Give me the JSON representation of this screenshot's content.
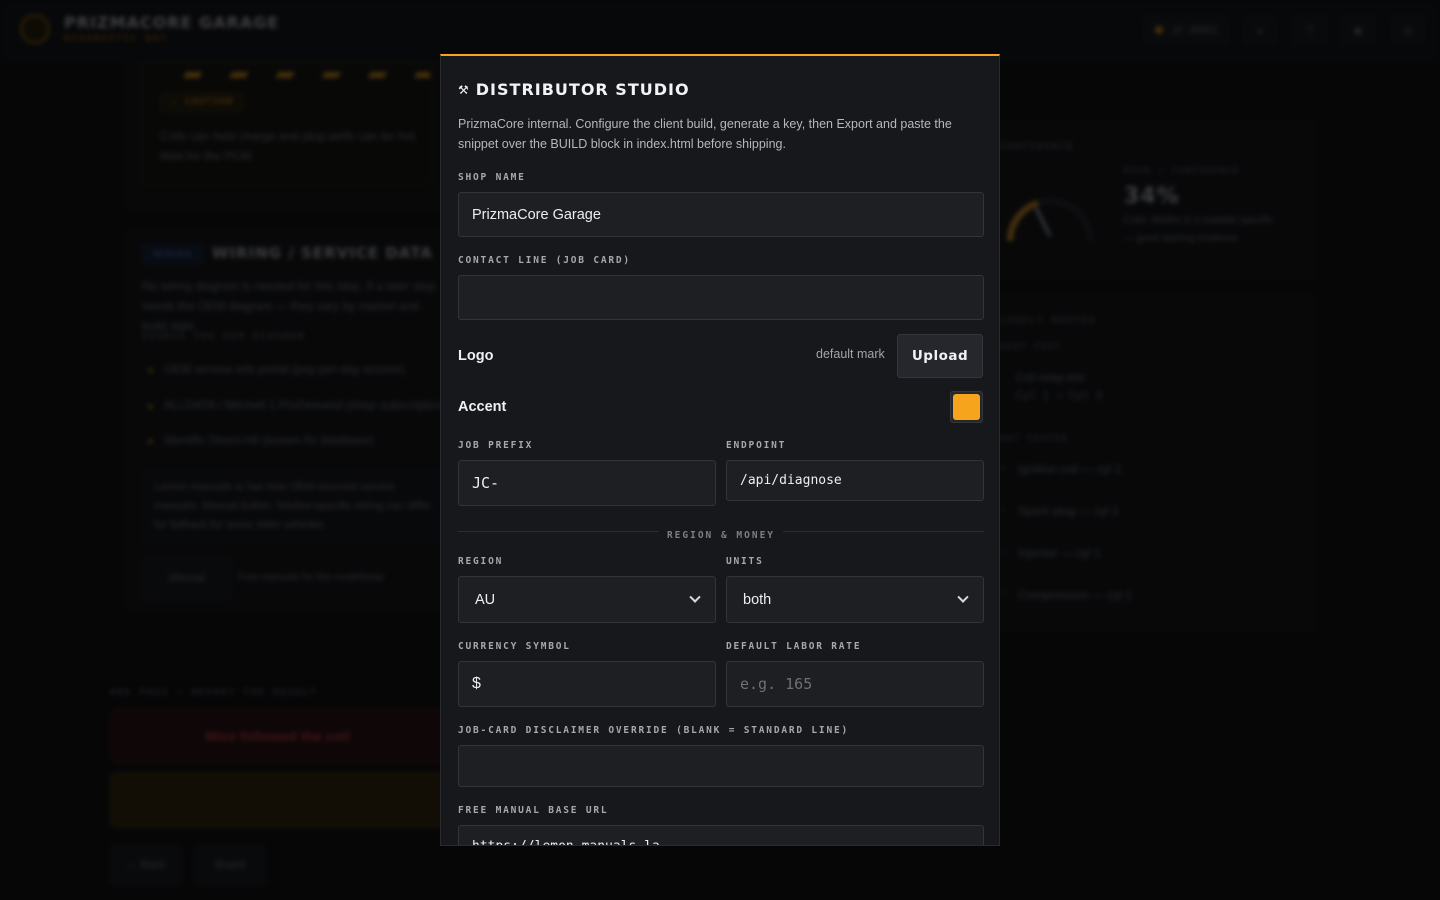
{
  "app": {
    "brand_name": "PRIZMACORE GARAGE",
    "brand_sub": "DIAGNOSTIC BAY",
    "pill_label": "JC-0001"
  },
  "background": {
    "caution_label": "⚠ CAUTION",
    "caution_text": "Coils can hold charge and plug wells can be hot. Wait for the PCM.",
    "wiring_badge": "WIRING",
    "wiring_title": "WIRING / SERVICE DATA",
    "wiring_text": "No wiring diagram is needed for this step. If a later step needs the OEM diagram — they vary by market and build date.",
    "sources_label": "SOURCE THE OEM DIAGRAM",
    "sources": [
      "OEM service info portal (pay-per-day access)",
      "ALLDATA / Mitchell 1 ProDemand (shop subscription)",
      "Identifix Direct-Hit (known-fix database)"
    ],
    "note_text": "Lemon manuals is has free OEM-sourced service manuals. Manual button. Market-specific wiring can differ for fallback for some older vehicles.",
    "manual_btn": "Manual",
    "manual_hint": "Free manuals for this model/year",
    "result_label": "ONE PASS — REPORT THE RESULT",
    "result_red": "Miss followed the coil",
    "back_btn": "← Back",
    "board_btn": "Board",
    "side_label": "CONFIDENCE",
    "side_sub": "RISK / CONFIDENCE",
    "side_value": "34%",
    "side_text": "Coils. Misfire is a suitable specific — good starting evidence.",
    "fault_label": "LIKELY ROUTES",
    "next_test_label": "NEXT TEST",
    "next_test": "Coil swap test",
    "next_test_detail": "Cyl 1 → Cyl 3",
    "tested_label": "NOT TESTED",
    "tested_items": [
      "Ignition coil — cyl 1",
      "Spark plug — cyl 1",
      "Injector — cyl 1",
      "Compression — cyl 1"
    ]
  },
  "modal": {
    "title": "DISTRIBUTOR STUDIO",
    "intro": "PrizmaCore internal. Configure the client build, generate a key, then Export and paste the snippet over the BUILD block in index.html before shipping.",
    "shop_name_label": "SHOP NAME",
    "shop_name_value": "PrizmaCore Garage",
    "contact_label": "CONTACT LINE (JOB CARD)",
    "contact_value": "",
    "logo_label": "Logo",
    "logo_status": "default mark",
    "upload_btn": "Upload",
    "accent_label": "Accent",
    "accent_color": "#f7a41d",
    "job_prefix_label": "JOB PREFIX",
    "job_prefix_value": "JC-",
    "endpoint_label": "ENDPOINT",
    "endpoint_value": "/api/diagnose",
    "section_region": "REGION & MONEY",
    "region_label": "REGION",
    "region_value": "AU",
    "units_label": "UNITS",
    "units_value": "both",
    "currency_label": "CURRENCY SYMBOL",
    "currency_value": "$",
    "labor_label": "DEFAULT LABOR RATE",
    "labor_placeholder": "e.g. 165",
    "disclaimer_label": "JOB-CARD DISCLAIMER OVERRIDE (BLANK = STANDARD LINE)",
    "disclaimer_value": "",
    "manual_url_label": "FREE MANUAL BASE URL",
    "manual_url_value": "https://lemon-manuals.la"
  }
}
